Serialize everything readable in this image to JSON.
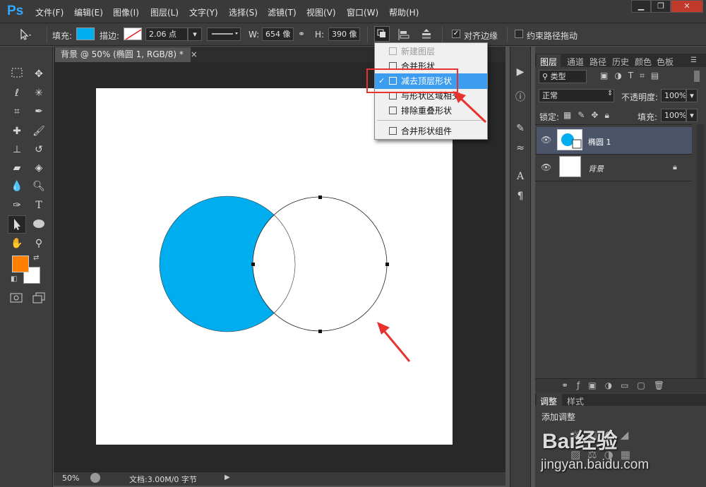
{
  "app": {
    "logo": "Ps"
  },
  "menu": [
    "文件(F)",
    "编辑(E)",
    "图像(I)",
    "图层(L)",
    "文字(Y)",
    "选择(S)",
    "滤镜(T)",
    "视图(V)",
    "窗口(W)",
    "帮助(H)"
  ],
  "window_buttons": [
    "▁",
    "❐",
    "✕"
  ],
  "options_bar": {
    "fill_label": "填充:",
    "fill_color": "#00aeef",
    "stroke_label": "描边:",
    "stroke_size": "2.06 点",
    "w_label": "W:",
    "w_value": "654 像",
    "h_label": "H:",
    "h_value": "390 像",
    "align_edges_label": "对齐边缘",
    "align_edges_checked": true,
    "constrain_path_label": "约束路径拖动",
    "constrain_path_checked": false
  },
  "document": {
    "tab_title": "背景 @ 50% (椭圆 1, RGB/8) *",
    "tab_close": "×",
    "shape_fill": "#00aeef",
    "zoom": "50%",
    "doc_info": "文档:3.00M/0 字节"
  },
  "path_ops_menu": {
    "items": [
      {
        "label": "新建图层",
        "disabled": true,
        "selected": false
      },
      {
        "label": "合并形状",
        "disabled": false,
        "selected": false
      },
      {
        "label": "减去顶层形状",
        "disabled": false,
        "selected": true
      },
      {
        "label": "与形状区域相交",
        "disabled": false,
        "selected": false
      },
      {
        "label": "排除重叠形状",
        "disabled": false,
        "selected": false
      },
      {
        "label": "合并形状组件",
        "disabled": false,
        "selected": false
      }
    ],
    "check_mark": "✓"
  },
  "panels": {
    "tabs": [
      "图层",
      "通道",
      "路径",
      "历史",
      "颜色",
      "色板"
    ],
    "filter_kind": "类型",
    "blend_mode": "正常",
    "opacity_label": "不透明度:",
    "opacity_value": "100%",
    "lock_label": "锁定:",
    "fill_label": "填充:",
    "fill_value": "100%",
    "layers": [
      {
        "name": "椭圆 1",
        "selected": true
      },
      {
        "name": "背景",
        "selected": false,
        "locked": true
      }
    ],
    "adjust_tabs": [
      "调整",
      "样式"
    ],
    "add_adjustment": "添加调整"
  },
  "tool_colors": {
    "foreground": "#ff7f00",
    "background": "#ffffff"
  },
  "watermark": {
    "brand": "Bai经验",
    "url": "jingyan.baidu.com"
  },
  "annotation_color": "#e8322e"
}
